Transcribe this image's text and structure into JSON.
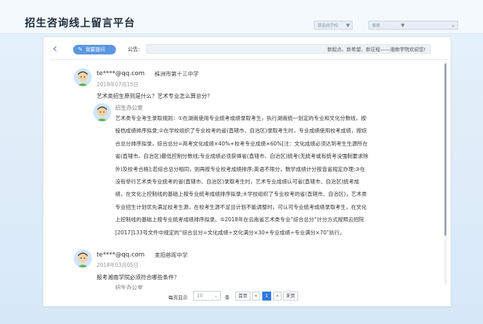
{
  "header": {
    "title": "招生咨询线上留言平台",
    "select_placeholder": "请选择学校",
    "search_placeholder": "搜索"
  },
  "toolbar": {
    "ask_label": "我要提问",
    "notice_label": "公告:",
    "notice_text": "新起点、新希望、新征程——湘南学院欢迎您!"
  },
  "messages": [
    {
      "user": "te****@qq.com",
      "school": "株洲市第十三中学",
      "date": "2018年07月15日",
      "question": "艺术类招生原则是什么？艺术专业怎么算总分？",
      "reply": {
        "name": "招生办公室",
        "lines": [
          "艺术类专业考生录取规则：①在湖南使用专业统考成绩录取考生，执行湖南统一划定的专业和文化分数线，按",
          "投档成绩排序拟录;②在学校组织了专业校考的省(直辖市、自治区)录取考生时，专业成绩使用校考成绩，按综",
          "合总分排序拟录，综合总分=高考文化成绩×40%+校考专业成绩×60%[注：文化成绩必须达到考生生源所在",
          "省(直辖市、自治区)最低控制分数线;专业成绩必须获得省(直辖市、自治区)统考(无统考或有统考没强制要求除",
          "外)及校考合格];若综合总分相同，则再按专业校考成绩排序;英语不限分，数学成绩计分按音省规定办理;③在",
          "没有举行艺术类专业统考的省(直辖市、自治区)录取考生时，艺术专业成绩认可省(直辖市、自治区)统考成",
          "绩，在文化上控制线的基础上按专业统考成绩排序拟录;④学校组织了专业校考的省(直辖市、自治区)，艺术类",
          "专业招生计划优先满足校考生源，在校考生源不足且计划不能调整时，可认可专业统考成绩录取考生，在文化",
          "上控制线的基础上按专业统考成绩排序拟录。⑤2018年在云南省艺术类专业“综合总分”计分方式按照云招院",
          "[2017]133号文件中规定的“综合总分=文化成绩÷文化满分×30+专业成绩÷专业满分×70”执行。"
        ]
      }
    },
    {
      "user": "te****@qq.com",
      "school": "耒阳慈晖中学",
      "date": "2018年03月05日",
      "question": "报考湘南学院必须符合哪些条件？",
      "reply": {
        "name": "招生办公室"
      }
    }
  ],
  "pagination": {
    "per_page_label": "每页显示",
    "per_page_value": "10",
    "unit": "条",
    "first": "首页",
    "prev": "«",
    "current": "1",
    "next": "»",
    "last": "末页"
  },
  "colors": {
    "accent": "#5b97e0",
    "active_page": "#2f7be0"
  }
}
